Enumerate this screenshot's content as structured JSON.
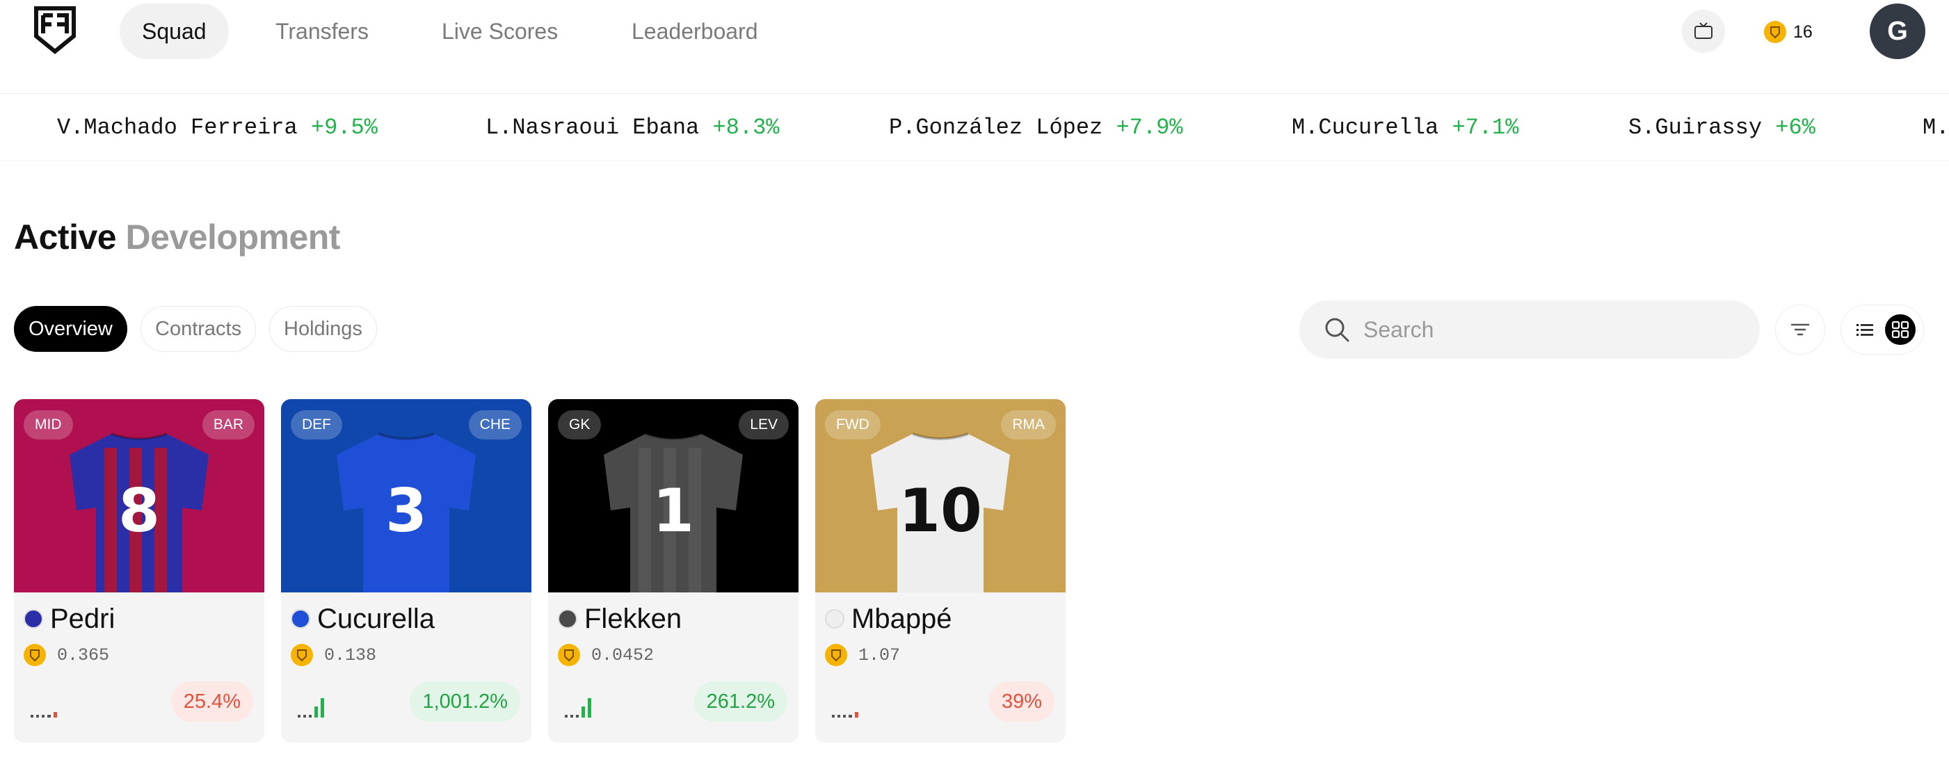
{
  "nav": {
    "tabs": [
      "Squad",
      "Transfers",
      "Live Scores",
      "Leaderboard"
    ],
    "coins": "16",
    "avatar_initial": "G",
    "icons": {
      "logo": "shield-logo-icon",
      "tv": "tv-icon",
      "coin": "coin-icon"
    }
  },
  "ticker": [
    {
      "name": "V.Machado Ferreira",
      "change": "+9.5%"
    },
    {
      "name": "L.Nasraoui Ebana",
      "change": "+8.3%"
    },
    {
      "name": "P.González López",
      "change": "+7.9%"
    },
    {
      "name": "M.Cucurella",
      "change": "+7.1%"
    },
    {
      "name": "S.Guirassy",
      "change": "+6%"
    },
    {
      "name": "M.",
      "change": ""
    }
  ],
  "heading": {
    "primary": "Active",
    "secondary": "Development"
  },
  "filters": {
    "tabs": [
      "Overview",
      "Contracts",
      "Holdings"
    ],
    "active": "Overview"
  },
  "search": {
    "placeholder": "Search",
    "value": ""
  },
  "colors": {
    "accent_green": "#22b24c",
    "accent_red": "#e0523d",
    "coin": "#f6b400"
  },
  "cards": [
    {
      "name": "Pedri",
      "position": "MID",
      "club": "BAR",
      "price": "0.365",
      "change": "25.4%",
      "trend": "down",
      "number": "8",
      "bg": "#b0104f",
      "shirt": "#2a2fa8",
      "stripe": "#a3163d",
      "numcolor": "#ffffff"
    },
    {
      "name": "Cucurella",
      "position": "DEF",
      "club": "CHE",
      "price": "0.138",
      "change": "1,001.2%",
      "trend": "up",
      "number": "3",
      "bg": "#0f47ad",
      "shirt": "#1f4fd6",
      "stripe": "#1f4fd6",
      "numcolor": "#ffffff"
    },
    {
      "name": "Flekken",
      "position": "GK",
      "club": "LEV",
      "price": "0.0452",
      "change": "261.2%",
      "trend": "up",
      "number": "1",
      "bg": "#000000",
      "shirt": "#4a4a4a",
      "stripe": "#555555",
      "numcolor": "#ffffff"
    },
    {
      "name": "Mbappé",
      "position": "FWD",
      "club": "RMA",
      "price": "1.07",
      "change": "39%",
      "trend": "down",
      "number": "10",
      "bg": "#c9a254",
      "shirt": "#eeeeee",
      "stripe": "#eeeeee",
      "numcolor": "#111111"
    }
  ]
}
